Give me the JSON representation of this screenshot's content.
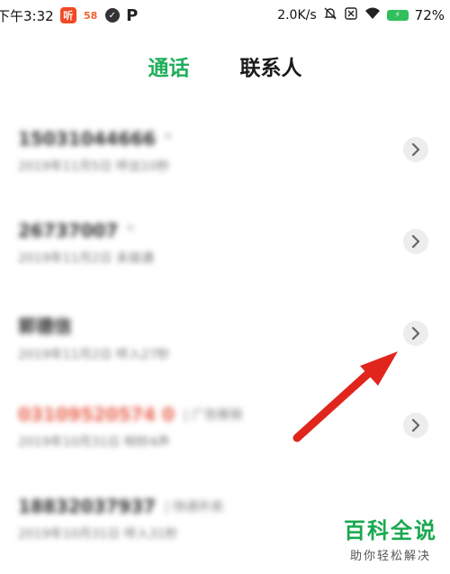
{
  "status_bar": {
    "time": "下午3:32",
    "app_badges": [
      "听",
      "58",
      "✓",
      "P"
    ],
    "net_speed": "2.0K/s",
    "icons": [
      "mute-bell-icon",
      "sim-off-icon",
      "wifi-icon",
      "battery-charging-icon"
    ],
    "battery_percent": "72%"
  },
  "tabs": [
    {
      "label": "通话",
      "active": true
    },
    {
      "label": "联系人",
      "active": false
    }
  ],
  "calls": [
    {
      "primary": "15031044666",
      "tag": "*",
      "secondary": "2019年11月5日 呼出10秒",
      "missed": false
    },
    {
      "primary": "26737007",
      "tag": "*",
      "secondary": "2019年11月2日 未接通",
      "missed": false
    },
    {
      "primary": "郭德信",
      "tag": "",
      "secondary": "2019年11月2日 呼入27秒",
      "missed": false
    },
    {
      "primary": "03109520574 0",
      "tag": "| 广告推销",
      "secondary": "2019年10月31日 响铃4声",
      "missed": true
    },
    {
      "primary": "18832037937",
      "tag": "| 快递外卖",
      "secondary": "2019年10月31日 呼入31秒",
      "missed": false
    }
  ],
  "watermark": {
    "title": "百科全说",
    "subtitle": "助你轻松解决"
  },
  "colors": {
    "accent": "#1fae5b",
    "missed": "#e8644f",
    "arrow": "#e0251d"
  }
}
